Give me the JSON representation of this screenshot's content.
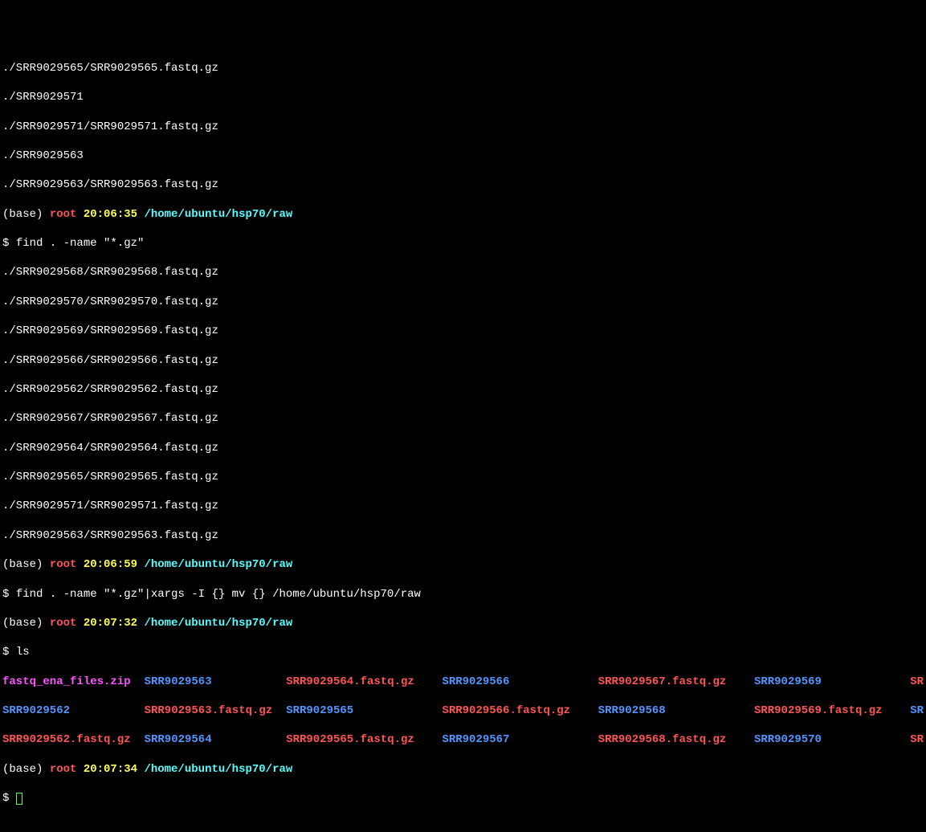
{
  "initial_output": [
    "./SRR9029565/SRR9029565.fastq.gz",
    "./SRR9029571",
    "./SRR9029571/SRR9029571.fastq.gz",
    "./SRR9029563",
    "./SRR9029563/SRR9029563.fastq.gz"
  ],
  "prompt1": {
    "base": "(base) ",
    "root": "root ",
    "time": "20:06:35 ",
    "path": "/home/ubuntu/hsp70/raw",
    "psym": "$ ",
    "cmd": "find . -name \"*.gz\""
  },
  "find_output": [
    "./SRR9029568/SRR9029568.fastq.gz",
    "./SRR9029570/SRR9029570.fastq.gz",
    "./SRR9029569/SRR9029569.fastq.gz",
    "./SRR9029566/SRR9029566.fastq.gz",
    "./SRR9029562/SRR9029562.fastq.gz",
    "./SRR9029567/SRR9029567.fastq.gz",
    "./SRR9029564/SRR9029564.fastq.gz",
    "./SRR9029565/SRR9029565.fastq.gz",
    "./SRR9029571/SRR9029571.fastq.gz",
    "./SRR9029563/SRR9029563.fastq.gz"
  ],
  "prompt2": {
    "base": "(base) ",
    "root": "root ",
    "time": "20:06:59 ",
    "path": "/home/ubuntu/hsp70/raw",
    "psym": "$ ",
    "cmd": "find . -name \"*.gz\"|xargs -I {} mv {} /home/ubuntu/hsp70/raw"
  },
  "prompt3": {
    "base": "(base) ",
    "root": "root ",
    "time": "20:07:32 ",
    "path": "/home/ubuntu/hsp70/raw",
    "psym": "$ ",
    "cmd": "ls"
  },
  "ls": {
    "r0c0": "fastq_ena_files.zip",
    "r0c1": "SRR9029563",
    "r0c2": "SRR9029564.fastq.gz",
    "r0c3": "SRR9029566",
    "r0c4": "SRR9029567.fastq.gz",
    "r0c5": "SRR9029569",
    "r0c6": "SR",
    "r1c0": "SRR9029562",
    "r1c1": "SRR9029563.fastq.gz",
    "r1c2": "SRR9029565",
    "r1c3": "SRR9029566.fastq.gz",
    "r1c4": "SRR9029568",
    "r1c5": "SRR9029569.fastq.gz",
    "r1c6": "SR",
    "r2c0": "SRR9029562.fastq.gz",
    "r2c1": "SRR9029564",
    "r2c2": "SRR9029565.fastq.gz",
    "r2c3": "SRR9029567",
    "r2c4": "SRR9029568.fastq.gz",
    "r2c5": "SRR9029570",
    "r2c6": "SR"
  },
  "prompt4": {
    "base": "(base) ",
    "root": "root ",
    "time": "20:07:34 ",
    "path": "/home/ubuntu/hsp70/raw",
    "psym": "$ "
  }
}
